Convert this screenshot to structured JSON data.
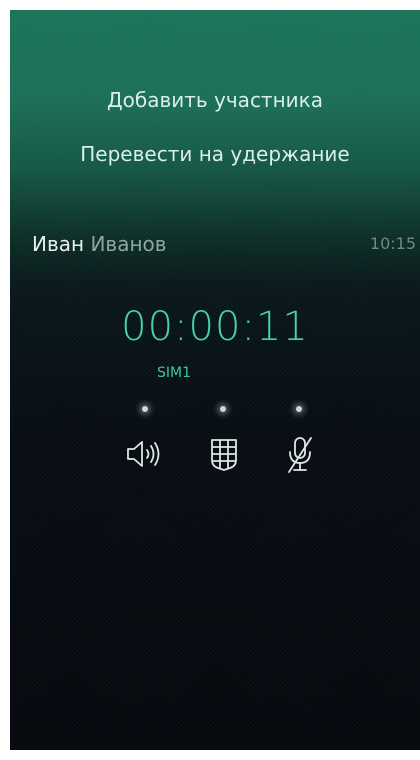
{
  "pulley_menu": {
    "items": [
      {
        "label": "Добавить участника"
      },
      {
        "label": "Перевести на удержание"
      }
    ]
  },
  "caller": {
    "first_name": "Иван",
    "last_name": "Иванов",
    "time": "10:15"
  },
  "call": {
    "duration": "00:00:11",
    "sim": "SIM1"
  },
  "controls": [
    {
      "name": "speaker",
      "icon": "speaker-icon",
      "active": false
    },
    {
      "name": "keypad",
      "icon": "keypad-icon",
      "active": false
    },
    {
      "name": "mute",
      "icon": "microphone-muted-icon",
      "active": false
    }
  ],
  "colors": {
    "accent": "#46d3a6",
    "header": "#1a735a",
    "background": "#04080d"
  }
}
